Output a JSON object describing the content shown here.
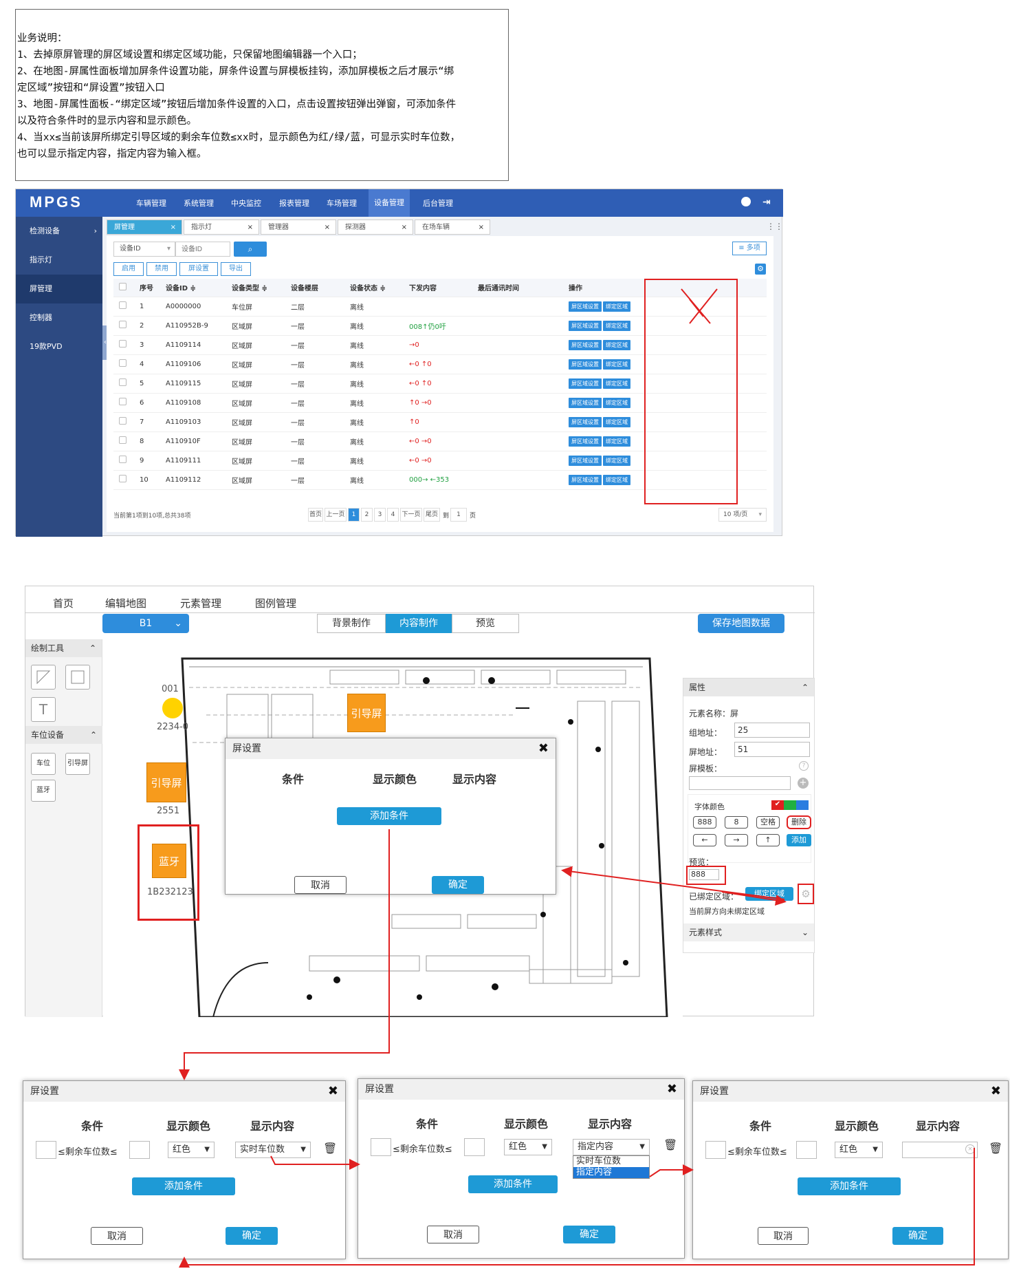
{
  "note": {
    "lines": [
      "业务说明：",
      "1、去掉原屏管理的屏区域设置和绑定区域功能，只保留地图编辑器一个入口；",
      "2、在地图-屏属性面板增加屏条件设置功能，屏条件设置与屏模板挂钩，添加屏模板之后才展示“绑",
      "定区域”按钮和“屏设置”按钮入口",
      "3、地图-屏属性面板-“绑定区域”按钮后增加条件设置的入口，点击设置按钮弹出弹窗，可添加条件",
      "以及符合条件时的显示内容和显示颜色。",
      "4、当xx≤当前该屏所绑定引导区域的剩余车位数≤xx时，显示颜色为红/绿/蓝，可显示实时车位数，",
      "也可以显示指定内容，指定内容为输入框。"
    ]
  },
  "app": {
    "logo": "MPGS",
    "nav": [
      "车辆管理",
      "系统管理",
      "中央监控",
      "报表管理",
      "车场管理",
      "设备管理",
      "后台管理"
    ],
    "sidebar": [
      "检测设备",
      "指示灯",
      "屏管理",
      "控制器",
      "19款PVD"
    ],
    "tabs": [
      "屏管理",
      "指示灯",
      "管理器",
      "探测器",
      "在场车辆"
    ],
    "filter": {
      "select": "设备ID",
      "placeholder": "设备ID",
      "more": "≡ 多项"
    },
    "actions": [
      "启用",
      "禁用",
      "屏设置",
      "导出"
    ],
    "columns": [
      "序号",
      "设备ID ≑",
      "设备类型 ≑",
      "设备楼层",
      "设备状态 ≑",
      "下发内容",
      "最后通讯时间",
      "操作"
    ],
    "rows": [
      [
        "1",
        "A0000000",
        "车位屏",
        "二层",
        "离线",
        ""
      ],
      [
        "2",
        "A110952B-9",
        "区域屏",
        "一层",
        "离线",
        "008↑仍0吁"
      ],
      [
        "3",
        "A1109114",
        "区域屏",
        "一层",
        "离线",
        "→0"
      ],
      [
        "4",
        "A1109106",
        "区域屏",
        "一层",
        "离线",
        "←0  ↑0"
      ],
      [
        "5",
        "A1109115",
        "区域屏",
        "一层",
        "离线",
        "←0  ↑0"
      ],
      [
        "6",
        "A1109108",
        "区域屏",
        "一层",
        "离线",
        "↑0  →0"
      ],
      [
        "7",
        "A1109103",
        "区域屏",
        "一层",
        "离线",
        "↑0"
      ],
      [
        "8",
        "A110910F",
        "区域屏",
        "一层",
        "离线",
        "←0  →0"
      ],
      [
        "9",
        "A1109111",
        "区域屏",
        "一层",
        "离线",
        "←0  →0"
      ],
      [
        "10",
        "A1109112",
        "区域屏",
        "一层",
        "离线",
        "000→ ←353"
      ]
    ],
    "op_buttons": [
      "屏区域设置",
      "绑定区域"
    ],
    "footer": "当前第1项到10项,总共38项",
    "pager": [
      "首页",
      "上一页",
      "1",
      "2",
      "3",
      "4",
      "下一页",
      "尾页",
      "到",
      "1",
      "页"
    ],
    "page_size": "10 项/页"
  },
  "editor": {
    "menu": [
      "首页",
      "编辑地图",
      "元素管理",
      "图例管理"
    ],
    "floor": "B1",
    "segments": [
      "背景制作",
      "内容制作",
      "预览"
    ],
    "save": "保存地图数据",
    "tools_title": "绘制工具",
    "devices_title": "车位设备",
    "device_buttons": [
      "车位",
      "引导屏",
      "蓝牙"
    ],
    "map_labels": {
      "spot_id": "001",
      "spot_code": "2234-0",
      "guide1": "引导屏",
      "guide2": "引导屏",
      "guide2_code": "2551",
      "bt": "蓝牙",
      "bt_code": "1B232123"
    },
    "props": {
      "title": "属性",
      "name_label": "元素名称：",
      "name_value": "屏",
      "group_label": "组地址：",
      "group_value": "25",
      "screen_label": "屏地址：",
      "screen_value": "51",
      "template_label": "屏模板：",
      "font_color_label": "字体颜色",
      "keys": [
        "888",
        "8",
        "空格",
        "删除",
        "←",
        "→",
        "↑",
        "添加"
      ],
      "preview_label": "预览：",
      "preview_value": "888",
      "bound_label": "已绑定区域：",
      "bind_button": "绑定区域",
      "unbound_text": "当前屏方向未绑定区域",
      "style_title": "元素样式"
    }
  },
  "dialog_main": {
    "title": "屏设置",
    "cols": [
      "条件",
      "显示颜色",
      "显示内容"
    ],
    "add": "添加条件",
    "cancel": "取消",
    "ok": "确定"
  },
  "dialogs": [
    {
      "title": "屏设置",
      "cols": [
        "条件",
        "显示颜色",
        "显示内容"
      ],
      "cond": "≤剩余车位数≤",
      "color": "红色",
      "content": "实时车位数",
      "add": "添加条件",
      "cancel": "取消",
      "ok": "确定"
    },
    {
      "title": "屏设置",
      "cols": [
        "条件",
        "显示颜色",
        "显示内容"
      ],
      "cond": "≤剩余车位数≤",
      "color": "红色",
      "content": "指定内容",
      "options": [
        "实时车位数",
        "指定内容"
      ],
      "add": "添加条件",
      "cancel": "取消",
      "ok": "确定"
    },
    {
      "title": "屏设置",
      "cols": [
        "条件",
        "显示颜色",
        "显示内容"
      ],
      "cond": "≤剩余车位数≤",
      "color": "红色",
      "content": "",
      "add": "添加条件",
      "cancel": "取消",
      "ok": "确定"
    }
  ],
  "colors": {
    "primary": "#2f5eb5",
    "accent": "#1e9ad6",
    "orange": "#f79b1c",
    "red": "#e02020"
  }
}
